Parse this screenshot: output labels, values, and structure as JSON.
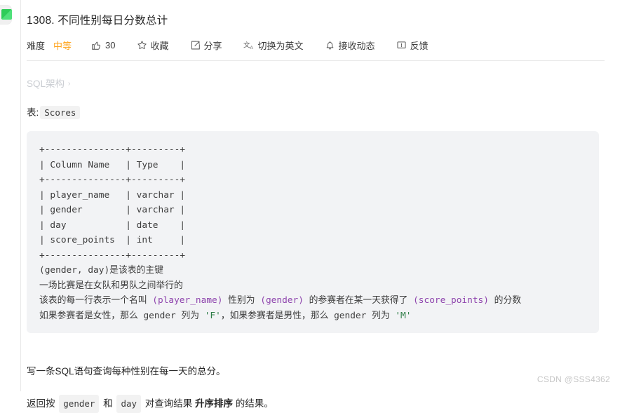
{
  "rail": {
    "app_icon_name": "green-app-icon"
  },
  "header": {
    "title": "1308. 不同性别每日分数总计"
  },
  "meta": {
    "difficulty_label": "难度",
    "difficulty_value": "中等",
    "like_count": "30",
    "favorite_label": "收藏",
    "share_label": "分享",
    "translate_label": "切换为英文",
    "subscribe_label": "接收动态",
    "feedback_label": "反馈",
    "icons": {
      "like": "thumbs-up-icon",
      "favorite": "star-icon",
      "share": "share-box-icon",
      "translate": "translate-icon",
      "subscribe": "bell-icon",
      "feedback": "comment-icon"
    }
  },
  "breadcrumb": {
    "label": "SQL架构",
    "chevron": "›"
  },
  "table_section": {
    "prefix": "表:",
    "table_name": "Scores"
  },
  "code_block": {
    "lines": [
      "+---------------+---------+",
      "| Column Name   | Type    |",
      "+---------------+---------+",
      "| player_name   | varchar |",
      "| gender        | varchar |",
      "| day           | date    |",
      "| score_points  | int     |",
      "+---------------+---------+",
      "(gender, day)是该表的主键",
      "一场比赛是在女队和男队之间举行的",
      "该表的每一行表示一个名叫 (player_name) 性别为 (gender) 的参赛者在某一天获得了 (score_points) 的分数",
      "如果参赛者是女性，那么 gender 列为 'F'，如果参赛者是男性，那么 gender 列为 'M'"
    ]
  },
  "body": {
    "paragraph_1": "写一条SQL语句查询每种性别在每一天的总分。",
    "paragraph_2": {
      "part_1": "返回按 ",
      "chip_1": "gender",
      "part_2": " 和 ",
      "chip_2": "day",
      "part_3": " 对查询结果 ",
      "emphasis": "升序排序",
      "part_4": " 的结果。"
    }
  },
  "watermark": {
    "text": "CSDN @SSS4362"
  },
  "colors": {
    "difficulty_medium": "#ffa116",
    "code_bg": "#f2f3f5",
    "chip_bg": "#f2f2f2",
    "breadcrumb_text": "#c9ccd1",
    "accent_green": "#2ecc58"
  }
}
